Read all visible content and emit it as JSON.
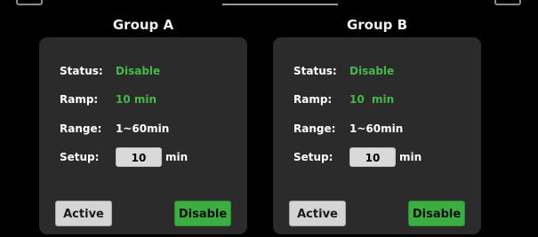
{
  "groups": [
    {
      "title": "Group A",
      "status_label": "Status:",
      "status_value": "Disable",
      "ramp_label": "Ramp:",
      "ramp_value": "10 min",
      "range_label": "Range:",
      "range_value": "1~60min",
      "setup_label": "Setup:",
      "setup_value": "10",
      "setup_unit": "min",
      "active_button": "Active",
      "disable_button": "Disable"
    },
    {
      "title": "Group B",
      "status_label": "Status:",
      "status_value": "Disable",
      "ramp_label": "Ramp:",
      "ramp_value": "10  min",
      "range_label": "Range:",
      "range_value": "1~60min",
      "setup_label": "Setup:",
      "setup_value": "10",
      "setup_unit": "min",
      "active_button": "Active",
      "disable_button": "Disable"
    }
  ],
  "colors": {
    "background": "#000000",
    "panel": "#2b2b2b",
    "accent_green": "#48b84a",
    "button_green": "#3bad43",
    "button_gray": "#d4d4d4"
  }
}
